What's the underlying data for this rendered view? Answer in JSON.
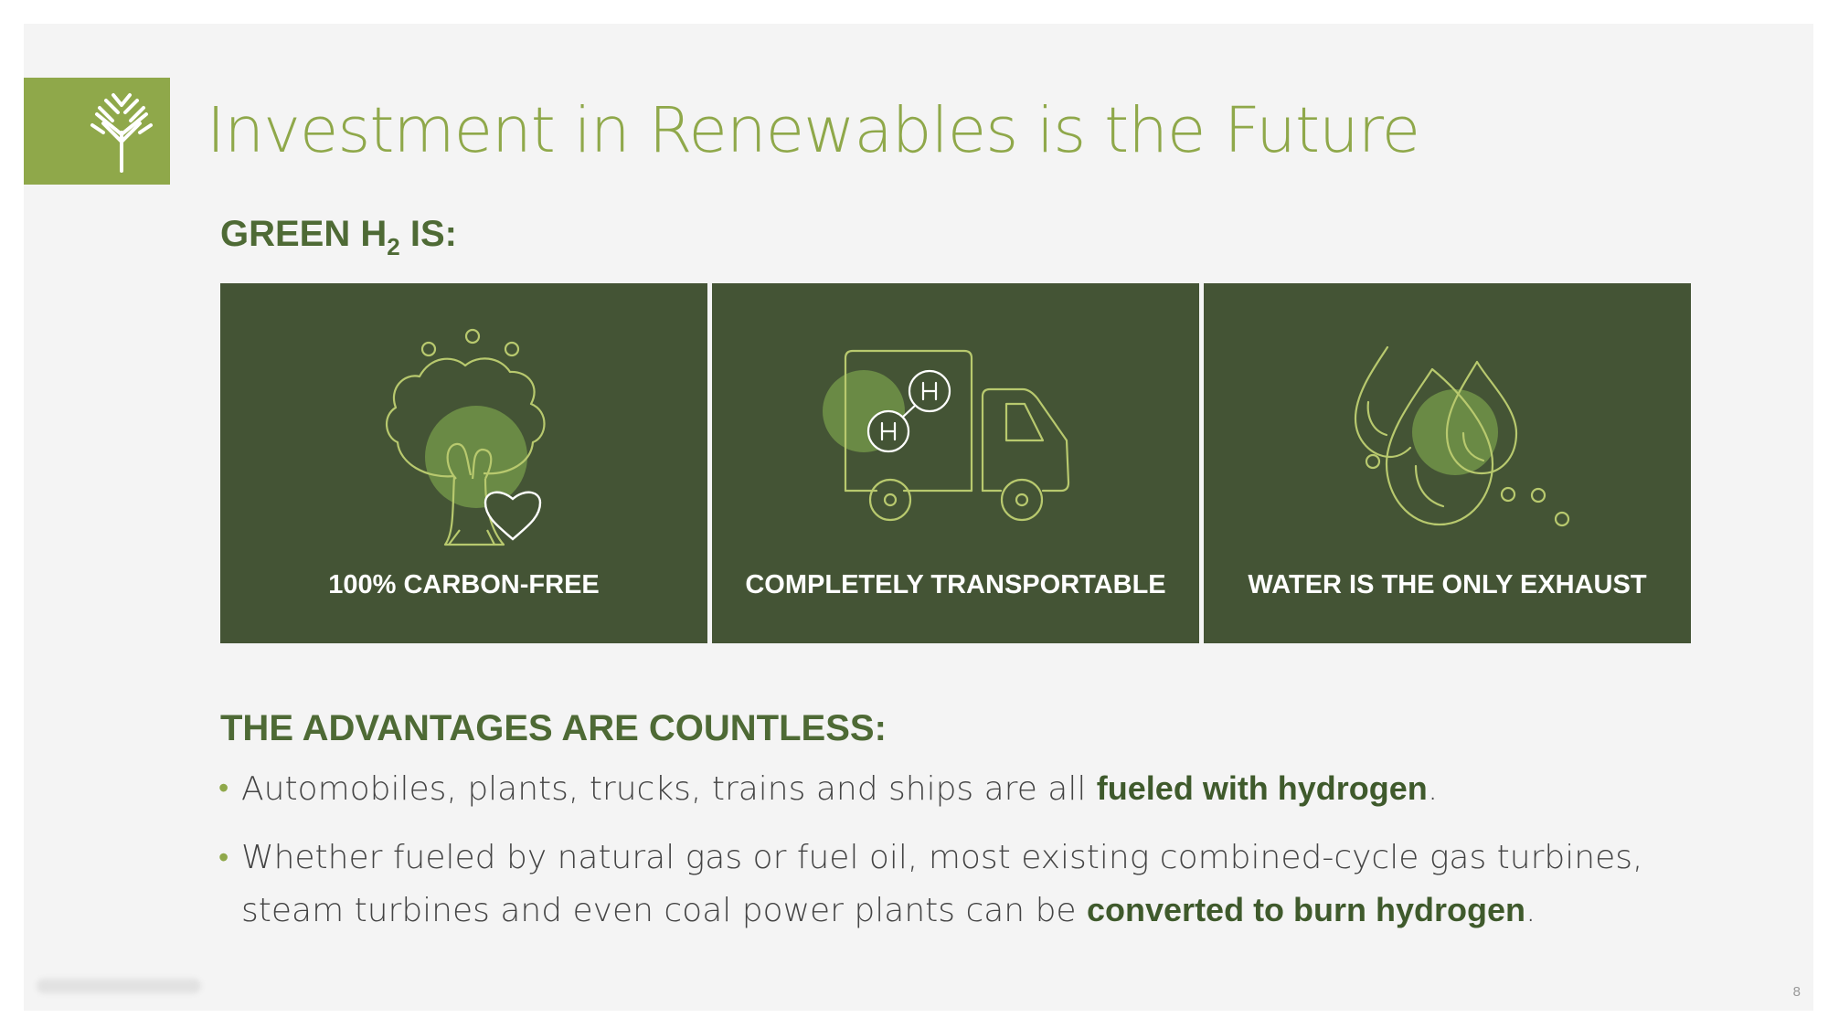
{
  "slide": {
    "title": "Investment in Renewables is the Future",
    "green_heading": {
      "prefix": "GREEN H",
      "subscript": "2",
      "suffix": " IS:"
    },
    "tiles": [
      {
        "label": "100% CARBON-FREE",
        "icon": "tree-heart-icon"
      },
      {
        "label": "COMPLETELY TRANSPORTABLE",
        "icon": "hydrogen-truck-icon"
      },
      {
        "label": "WATER IS THE ONLY EXHAUST",
        "icon": "water-drops-icon"
      }
    ],
    "advantages_heading": "THE ADVANTAGES ARE COUNTLESS:",
    "bullets": [
      {
        "text": "Automobiles, plants, trucks, trains and ships are all ",
        "bold": "fueled with hydrogen",
        "end": "."
      },
      {
        "text": "Whether fueled by natural gas or fuel oil, most existing combined-cycle gas turbines, steam turbines and even coal power plants can be ",
        "bold": "converted to burn hydrogen",
        "end": "."
      }
    ],
    "page_number": "8"
  },
  "colors": {
    "accent": "#8fa84a",
    "dark_green": "#445435",
    "heading_green": "#4e6a35",
    "icon_line": "#b8c96e",
    "icon_fill": "#6a8a45"
  }
}
